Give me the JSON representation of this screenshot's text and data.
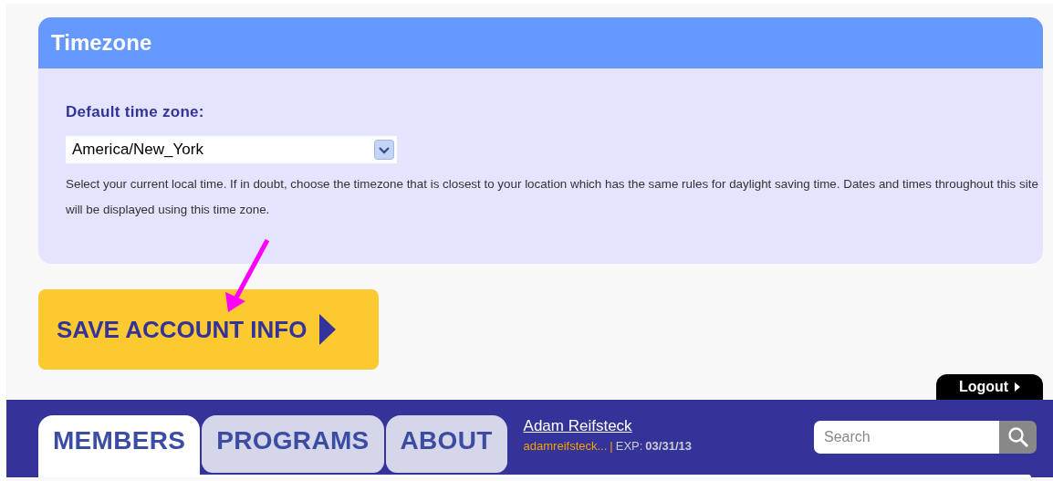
{
  "panel": {
    "title": "Timezone",
    "field_label": "Default time zone:",
    "select_value": "America/New_York",
    "help": "Select your current local time. If in doubt, choose the timezone that is closest to your location which has the same rules for daylight saving time. Dates and times throughout this site will be displayed using this time zone."
  },
  "save_button": {
    "label": "SAVE ACCOUNT INFO"
  },
  "logout": {
    "label": "Logout"
  },
  "tabs": [
    {
      "label": "MEMBERS",
      "selected": true
    },
    {
      "label": "PROGRAMS",
      "selected": false
    },
    {
      "label": "ABOUT",
      "selected": false
    }
  ],
  "user": {
    "name": "Adam Reifsteck",
    "username": "adamreifsteck...",
    "separator": "|",
    "exp_label": "EXP:",
    "exp_date": "03/31/13"
  },
  "search": {
    "placeholder": "Search"
  }
}
